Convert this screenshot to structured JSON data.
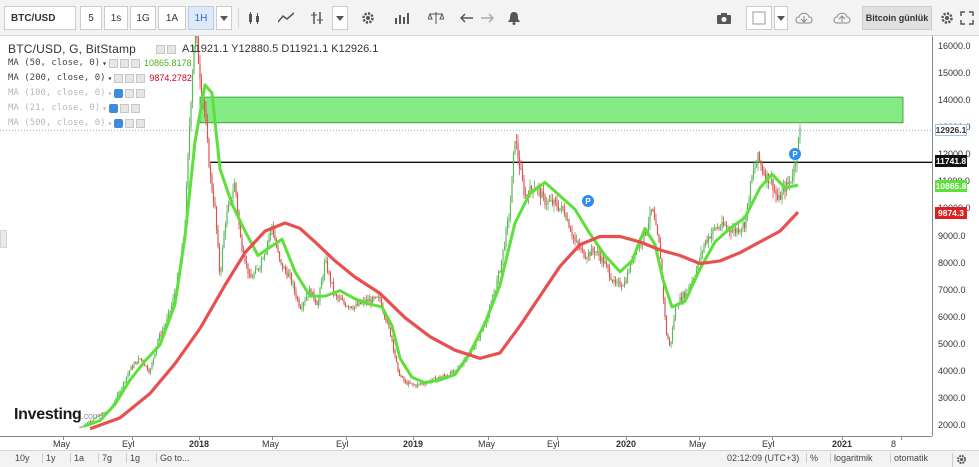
{
  "toolbar": {
    "symbol": "BTC/USD",
    "intervals": [
      "5",
      "1s",
      "1G",
      "1A",
      "1H"
    ],
    "active_interval": "1H",
    "right_label": "Bitcoin günlük"
  },
  "legend": {
    "symbol_line": "BTC/USD, G, BitStamp",
    "ohlc": "A11921.1  Y12880.5  D11921.1  K12926.1",
    "ma": [
      {
        "label": "MA (50, close, 0)",
        "value": "10865.8178",
        "color": "#4caf1e",
        "faded": false
      },
      {
        "label": "MA (200, close, 0)",
        "value": "9874.2782",
        "color": "#d0021b",
        "faded": false
      },
      {
        "label": "MA (100, close, 0)",
        "value": "",
        "color": "#b8b8b8",
        "faded": true
      },
      {
        "label": "MA (21, close, 0)",
        "value": "",
        "color": "#b8b8b8",
        "faded": true
      },
      {
        "label": "MA (500, close, 0)",
        "value": "",
        "color": "#b8b8b8",
        "faded": true
      }
    ]
  },
  "price_axis": {
    "ticks": [
      "16000.0",
      "15000.0",
      "14000.0",
      "13000.0",
      "12000.0",
      "11000.0",
      "10000.0",
      "9000.0",
      "8000.0",
      "7000.0",
      "6000.0",
      "5000.0",
      "4000.0",
      "3000.0",
      "2000.0"
    ],
    "tags": [
      {
        "text": "12926.1",
        "bg": "#ffffff",
        "fg": "#333333",
        "border": "#9ec3ef"
      },
      {
        "text": "11741.8",
        "bg": "#111111",
        "fg": "#ffffff",
        "border": "#111111"
      },
      {
        "text": "10865.8",
        "bg": "#5ee03a",
        "fg": "#ffffff",
        "border": "#5ee03a"
      },
      {
        "text": "9874.3",
        "bg": "#e02020",
        "fg": "#ffffff",
        "border": "#e02020"
      }
    ]
  },
  "time_axis": {
    "ticks": [
      {
        "label": "May",
        "bold": false
      },
      {
        "label": "Eyl",
        "bold": false
      },
      {
        "label": "2018",
        "bold": true
      },
      {
        "label": "May",
        "bold": false
      },
      {
        "label": "Eyl",
        "bold": false
      },
      {
        "label": "2019",
        "bold": true
      },
      {
        "label": "May",
        "bold": false
      },
      {
        "label": "Eyl",
        "bold": false
      },
      {
        "label": "2020",
        "bold": true
      },
      {
        "label": "May",
        "bold": false
      },
      {
        "label": "Eyl",
        "bold": false
      },
      {
        "label": "2021",
        "bold": true
      },
      {
        "label": "8",
        "bold": false
      }
    ]
  },
  "logo": {
    "name": "Investing",
    "suffix": ".com"
  },
  "pins": [
    "P",
    "P"
  ],
  "bottom_bar": {
    "ranges": [
      "10y",
      "1y",
      "1a",
      "7g",
      "1g"
    ],
    "goto": "Go to...",
    "clock": "02:12:09 (UTC+3)",
    "percent": "%",
    "log": "logaritmik",
    "auto": "otomatik"
  },
  "colors": {
    "candle_up": "#5cb85c",
    "candle_down": "#d9534f",
    "ma50": "#5ee03a",
    "ma200": "#e85050",
    "zone_fill": "#6ee86e",
    "support_line": "#111111"
  }
}
